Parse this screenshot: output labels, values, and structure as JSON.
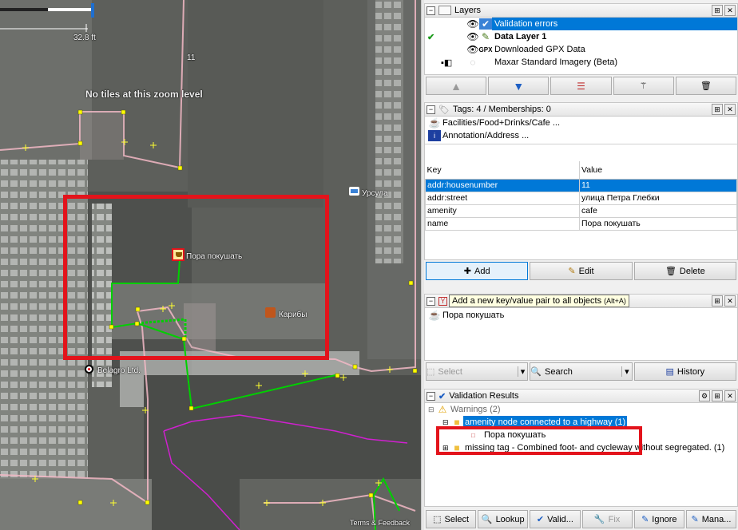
{
  "map": {
    "scale_label": "32.8 ft",
    "no_tiles": "No tiles at this zoom level",
    "label_11": "11",
    "poi_ursula": "Урсула",
    "poi_pora": "Пора покушать",
    "poi_karibi": "Карибы",
    "poi_belagro": "Belagro Ltd.",
    "attribution": "Terms & Feedback"
  },
  "layers": {
    "title": "Layers",
    "items": [
      "Validation errors",
      "Data Layer 1",
      "Downloaded GPX Data",
      "Maxar Standard Imagery (Beta)"
    ],
    "gpx_prefix": "GPX"
  },
  "tags": {
    "title": "Tags: 4 / Memberships: 0",
    "presets": [
      "Facilities/Food+Drinks/Cafe ...",
      "Annotation/Address ..."
    ],
    "col_key": "Key",
    "col_value": "Value",
    "rows": [
      {
        "key": "addr:housenumber",
        "value": "11"
      },
      {
        "key": "addr:street",
        "value": "улица Петра Глебки"
      },
      {
        "key": "amenity",
        "value": "cafe"
      },
      {
        "key": "name",
        "value": "Пора покушать"
      }
    ],
    "add": "Add",
    "edit": "Edit",
    "delete": "Delete"
  },
  "selection": {
    "tooltip": "Add a new key/value pair to all objects",
    "tooltip_shortcut": "(Alt+A)",
    "item": "Пора покушать",
    "select": "Select",
    "search": "Search",
    "history": "History"
  },
  "validation": {
    "title": "Validation Results",
    "warnings": "Warnings (2)",
    "item1": "amenity node connected to a highway (1)",
    "item1_child": "Пора покушать",
    "item2": "missing tag - Combined foot- and cycleway without segregated. (1)",
    "buttons": [
      "Select",
      "Lookup",
      "Valid...",
      "Fix",
      "Ignore",
      "Mana..."
    ]
  },
  "colors": {
    "selection": "#0078d7",
    "highlight_box": "#e3131b",
    "way": "#f3b9c6",
    "path": "#00d000",
    "track": "#d020d0"
  }
}
